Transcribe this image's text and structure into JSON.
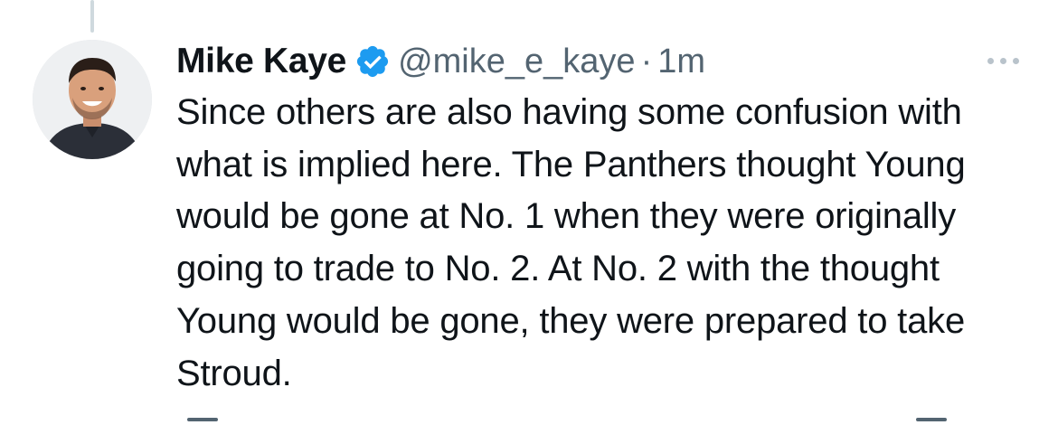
{
  "tweet": {
    "author": {
      "display_name": "Mike Kaye",
      "handle": "@mike_e_kaye",
      "verified": true
    },
    "separator": "·",
    "timestamp": "1m",
    "text": "Since others are also having some confusion with what is implied here. The Panthers thought Young would be gone at No. 1 when they were originally going to trade to No. 2. At No. 2 with the thought Young would be gone, they were prepared to take Stroud."
  },
  "colors": {
    "text_primary": "#0f1419",
    "text_secondary": "#536471",
    "verified_blue": "#1d9bf0",
    "thread_line": "#cfd9de"
  },
  "icons": {
    "verified": "verified-badge-icon",
    "more": "more-horizontal-icon"
  }
}
